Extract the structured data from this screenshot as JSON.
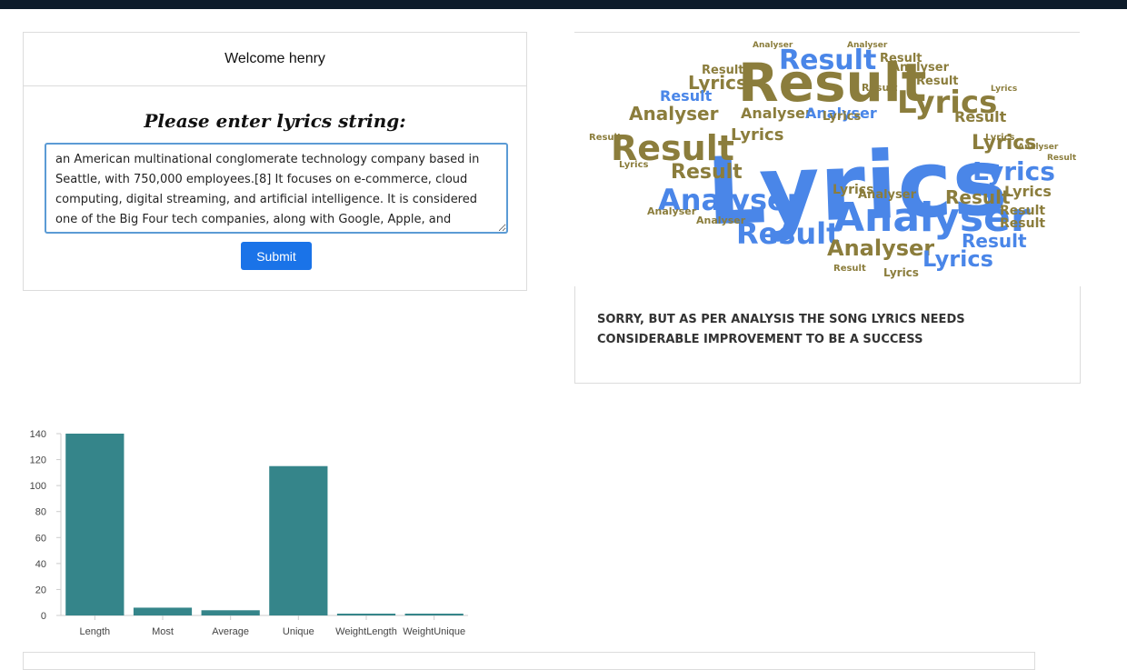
{
  "header": {
    "welcome": "Welcome henry"
  },
  "form": {
    "prompt": "Please enter lyrics string:",
    "lyrics_value": "an American multinational conglomerate technology company based in Seattle, with 750,000 employees.[8] It focuses on e-commerce, cloud computing, digital streaming, and artificial intelligence. It is considered one of the Big Four tech companies, along with Google, Apple, and Microsoft.",
    "submit_label": "Submit"
  },
  "wordcloud": {
    "words": [
      "Lyrics",
      "Result",
      "Analyser"
    ],
    "colors": {
      "blue": "#4a86e8",
      "olive": "#8b7d3c"
    }
  },
  "result": {
    "verdict": "SORRY, BUT AS PER ANALYSIS THE SONG LYRICS NEEDS CONSIDERABLE IMPROVEMENT TO BE A SUCCESS"
  },
  "colors": {
    "bar": "#35858a",
    "accent": "#1a73e8"
  },
  "chart_data": {
    "type": "bar",
    "categories": [
      "Length",
      "Most",
      "Average",
      "Unique",
      "WeightLength",
      "WeightUnique"
    ],
    "values": [
      140,
      6,
      4,
      115,
      1,
      1
    ],
    "ylim": [
      0,
      140
    ],
    "yticks": [
      0,
      20,
      40,
      60,
      80,
      100,
      120,
      140
    ],
    "grid": false,
    "legend": "none"
  }
}
